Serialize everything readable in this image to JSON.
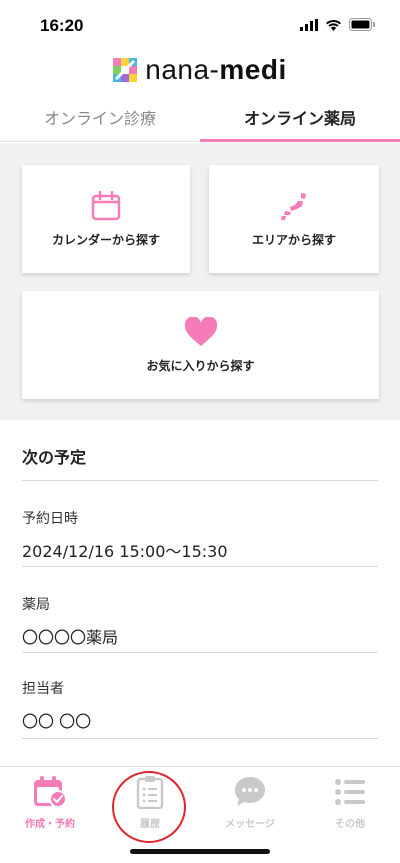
{
  "status_bar": {
    "time": "16:20"
  },
  "brand": {
    "name_prefix": "nana-",
    "name_suffix": "medi"
  },
  "tabs": [
    {
      "label": "オンライン診療",
      "active": false
    },
    {
      "label": "オンライン薬局",
      "active": true
    }
  ],
  "search": {
    "calendar_label": "カレンダーから探す",
    "area_label": "エリアから探す",
    "favorite_label": "お気に入りから探す"
  },
  "schedule": {
    "title": "次の予定",
    "datetime_label": "予約日時",
    "datetime_value": "2024/12/16 15:00〜15:30",
    "pharmacy_label": "薬局",
    "pharmacy_value": "〇〇〇〇薬局",
    "staff_label": "担当者",
    "staff_value": "〇〇 〇〇"
  },
  "bottom_nav": [
    {
      "label": "作成・予約",
      "icon": "calendar-check-icon",
      "active": true
    },
    {
      "label": "履歴",
      "icon": "clipboard-icon",
      "active": false
    },
    {
      "label": "メッセージ",
      "icon": "chat-bubble-icon",
      "active": false
    },
    {
      "label": "その他",
      "icon": "list-icon",
      "active": false
    }
  ],
  "colors": {
    "accent": "#f57cb7",
    "inactive": "#c9c9c9",
    "highlight_circle": "#e0242b",
    "panel_bg": "#f1f1f1"
  }
}
